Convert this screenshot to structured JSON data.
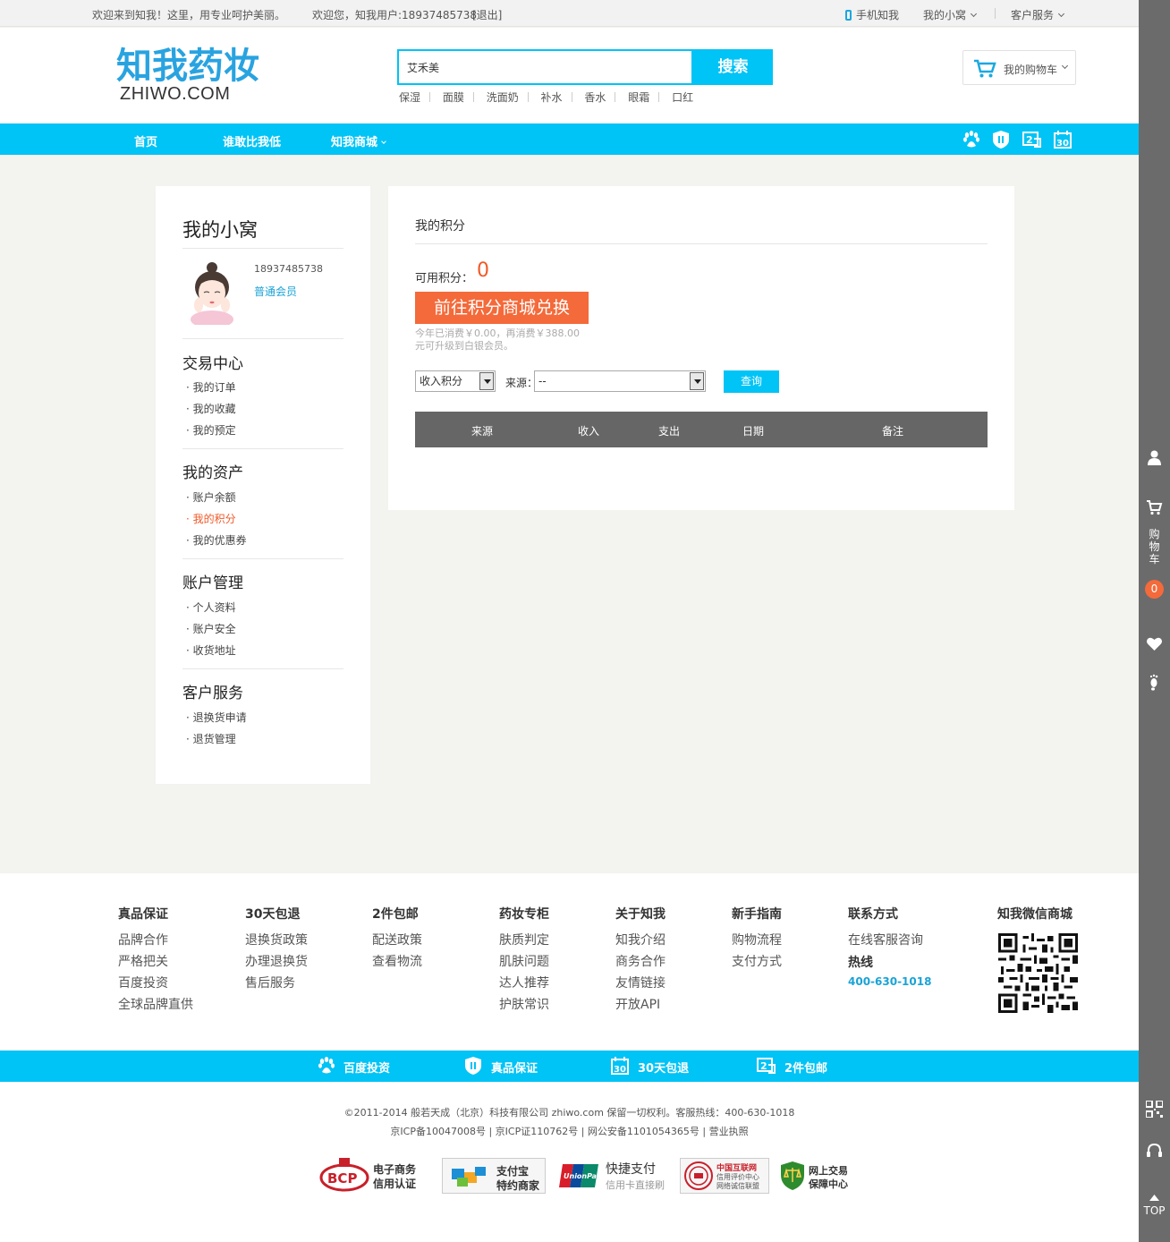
{
  "topbar": {
    "welcome": "欢迎来到知我！这里，用专业呵护美丽。",
    "greeting": "欢迎您，知我用户:18937485738",
    "logout": "[退出]",
    "mobile": "手机知我",
    "myhome": "我的小窝",
    "service": "客户服务"
  },
  "header": {
    "logo_cn": "知我药妆",
    "logo_en": "ZHIWO.COM",
    "search_value": "艾禾美",
    "search_button": "搜索",
    "hotwords": [
      "保湿",
      "面膜",
      "洗面奶",
      "补水",
      "香水",
      "眼霜",
      "口红"
    ],
    "cart_label": "我的购物车"
  },
  "nav": {
    "items": [
      "首页",
      "谁敢比我低",
      "知我商城"
    ]
  },
  "sidebar": {
    "title": "我的小窝",
    "phone": "18937485738",
    "level": "普通会员",
    "groups": [
      {
        "title": "交易中心",
        "items": [
          "我的订单",
          "我的收藏",
          "我的预定"
        ]
      },
      {
        "title": "我的资产",
        "items": [
          "账户余额",
          "我的积分",
          "我的优惠券"
        ]
      },
      {
        "title": "账户管理",
        "items": [
          "个人资料",
          "账户安全",
          "收货地址"
        ]
      },
      {
        "title": "客户服务",
        "items": [
          "退换货申请",
          "退货管理"
        ]
      }
    ]
  },
  "main": {
    "title": "我的积分",
    "points_label": "可用积分：",
    "points_value": "0",
    "exchange_button": "前往积分商城兑换",
    "upgrade_line1": "今年已消费￥0.00，再消费￥388.00",
    "upgrade_line2": "元可升级到白银会员。",
    "type_select": "收入积分",
    "source_label": "来源：",
    "source_select": "--",
    "query_button": "查询",
    "table_headers": [
      "来源",
      "收入",
      "支出",
      "日期",
      "备注"
    ]
  },
  "footer": {
    "columns": [
      {
        "title": "真品保证",
        "items": [
          "品牌合作",
          "严格把关",
          "百度投资",
          "全球品牌直供"
        ]
      },
      {
        "title": "30天包退",
        "items": [
          "退换货政策",
          "办理退换货",
          "售后服务"
        ]
      },
      {
        "title": "2件包邮",
        "items": [
          "配送政策",
          "查看物流"
        ]
      },
      {
        "title": "药妆专柜",
        "items": [
          "肤质判定",
          "肌肤问题",
          "达人推荐",
          "护肤常识"
        ]
      },
      {
        "title": "关于知我",
        "items": [
          "知我介绍",
          "商务合作",
          "友情链接",
          "开放API"
        ]
      },
      {
        "title": "新手指南",
        "items": [
          "购物流程",
          "支付方式"
        ]
      },
      {
        "title": "联系方式",
        "items": [
          "在线客服咨询"
        ]
      }
    ],
    "hotline_label": "热线",
    "hotline_number": "400-630-1018",
    "wechat_title": "知我微信商城",
    "bar_items": [
      "百度投资",
      "真品保证",
      "30天包退",
      "2件包邮"
    ],
    "copyright": "©2011-2014 般若天成（北京）科技有限公司 zhiwo.com 保留一切权利。客服热线：400-630-1018",
    "icp": "京ICP备10047008号 | 京ICP证110762号 | 网公安备1101054365号 | 营业执照",
    "badges": {
      "bcp_1": "电子商务",
      "bcp_2": "信用认证",
      "alipay_1": "支付宝",
      "alipay_2": "特约商家",
      "unionpay_1": "快捷支付",
      "unionpay_2": "信用卡直接刷",
      "cnnic_1": "中国互联网",
      "cnnic_2": "信用评价中心",
      "cnnic_3": "网络诚信联盟",
      "trade_1": "网上交易",
      "trade_2": "保障中心"
    }
  },
  "rail": {
    "cart_label": "购物车",
    "cart_count": "0",
    "top_label": "TOP"
  },
  "colors": {
    "brand_blue": "#00c3f6",
    "accent_orange": "#f46a3a",
    "rail_gray": "#6b6b6b"
  }
}
